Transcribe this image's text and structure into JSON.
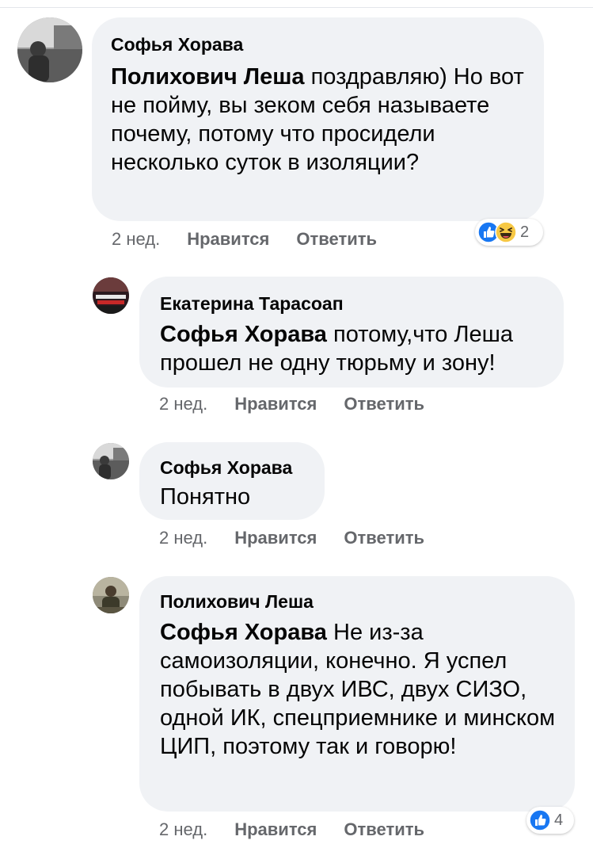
{
  "comments": [
    {
      "author": "Софья Хорава",
      "mention": "Полихович Леша",
      "text": " поздравляю) Но вот не пойму, вы зеком себя называете почему, потому что просидели несколько суток в изоляции?",
      "time": "2 нед.",
      "like_label": "Нравится",
      "reply_label": "Ответить",
      "reactions": {
        "icons": [
          "like-icon",
          "haha-icon"
        ],
        "count": "2"
      }
    },
    {
      "author": "Екатерина Тарасоап",
      "mention": "Софья Хорава",
      "text": " потому,что Леша прошел не одну тюрьму и зону!",
      "time": "2 нед.",
      "like_label": "Нравится",
      "reply_label": "Ответить"
    },
    {
      "author": "Софья Хорава",
      "mention": "",
      "text": "Понятно",
      "time": "2 нед.",
      "like_label": "Нравится",
      "reply_label": "Ответить"
    },
    {
      "author": "Полихович Леша",
      "mention": "Софья Хорава",
      "text": " Не из-за самоизоляции, конечно. Я успел побывать в двух ИВС, двух СИЗО, одной ИК, спецприемнике и минском ЦИП, поэтому так и говорю!",
      "time": "2 нед.",
      "like_label": "Нравится",
      "reply_label": "Ответить",
      "reactions": {
        "icons": [
          "like-icon"
        ],
        "count": "4"
      }
    }
  ],
  "colors": {
    "bubble_bg": "#f0f2f5",
    "meta_text": "#65676b",
    "like_blue": "#1877f2",
    "haha_yellow": "#f7c844"
  }
}
